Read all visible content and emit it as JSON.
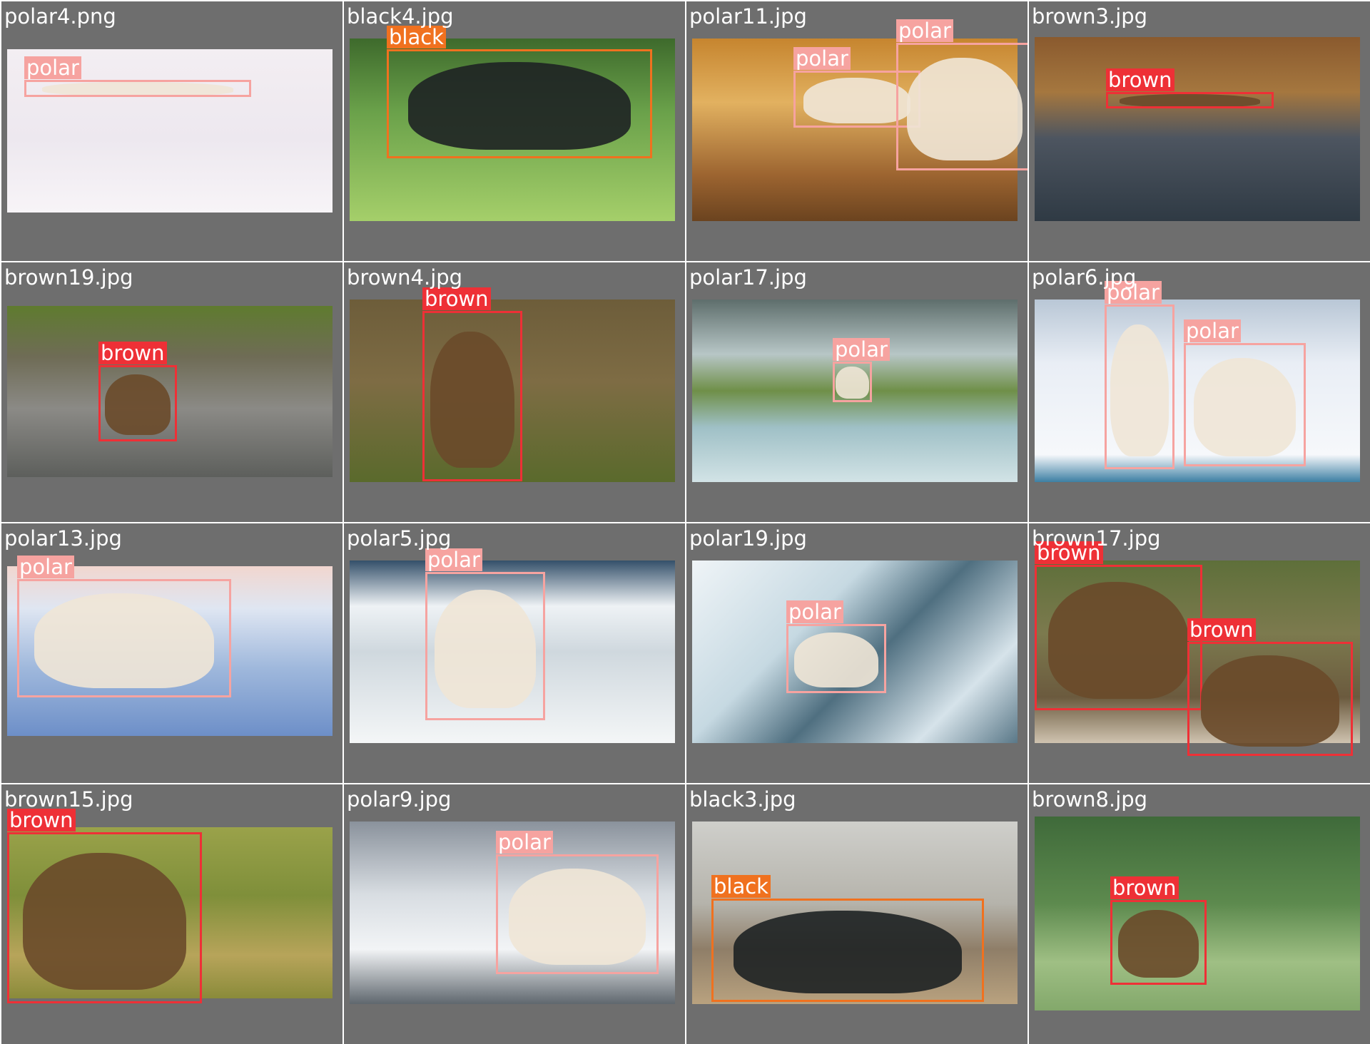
{
  "class_colors": {
    "polar": "#f6a3a0",
    "black": "#f0711f",
    "brown": "#ee3036"
  },
  "panels": [
    {
      "file": "polar4.png",
      "scene": "snow-white",
      "detections": [
        {
          "label": "polar"
        }
      ]
    },
    {
      "file": "black4.jpg",
      "scene": "green-grass",
      "detections": [
        {
          "label": "black"
        }
      ]
    },
    {
      "file": "polar11.jpg",
      "scene": "golden-grass",
      "detections": [
        {
          "label": "polar"
        },
        {
          "label": "polar"
        }
      ]
    },
    {
      "file": "brown3.jpg",
      "scene": "river-autumn",
      "detections": [
        {
          "label": "brown"
        }
      ]
    },
    {
      "file": "brown19.jpg",
      "scene": "rocky-stream",
      "detections": [
        {
          "label": "brown"
        }
      ]
    },
    {
      "file": "brown4.jpg",
      "scene": "meadow-brown",
      "detections": [
        {
          "label": "brown"
        }
      ]
    },
    {
      "file": "polar17.jpg",
      "scene": "misty-water",
      "detections": [
        {
          "label": "polar"
        }
      ]
    },
    {
      "file": "polar6.jpg",
      "scene": "snow-blue",
      "detections": [
        {
          "label": "polar"
        },
        {
          "label": "polar"
        }
      ]
    },
    {
      "file": "polar13.jpg",
      "scene": "snow-sunset",
      "detections": [
        {
          "label": "polar"
        }
      ]
    },
    {
      "file": "polar5.jpg",
      "scene": "snow-sea",
      "detections": [
        {
          "label": "polar"
        }
      ]
    },
    {
      "file": "polar19.jpg",
      "scene": "ice-floe",
      "detections": [
        {
          "label": "polar"
        }
      ]
    },
    {
      "file": "brown17.jpg",
      "scene": "forest-log",
      "detections": [
        {
          "label": "brown"
        },
        {
          "label": "brown"
        }
      ]
    },
    {
      "file": "brown15.jpg",
      "scene": "grass-fish",
      "detections": [
        {
          "label": "brown"
        }
      ]
    },
    {
      "file": "polar9.jpg",
      "scene": "ice-shore",
      "detections": [
        {
          "label": "polar"
        }
      ]
    },
    {
      "file": "black3.jpg",
      "scene": "barn-floor",
      "detections": [
        {
          "label": "black"
        }
      ]
    },
    {
      "file": "brown8.jpg",
      "scene": "green-hills",
      "detections": [
        {
          "label": "brown"
        }
      ]
    }
  ]
}
